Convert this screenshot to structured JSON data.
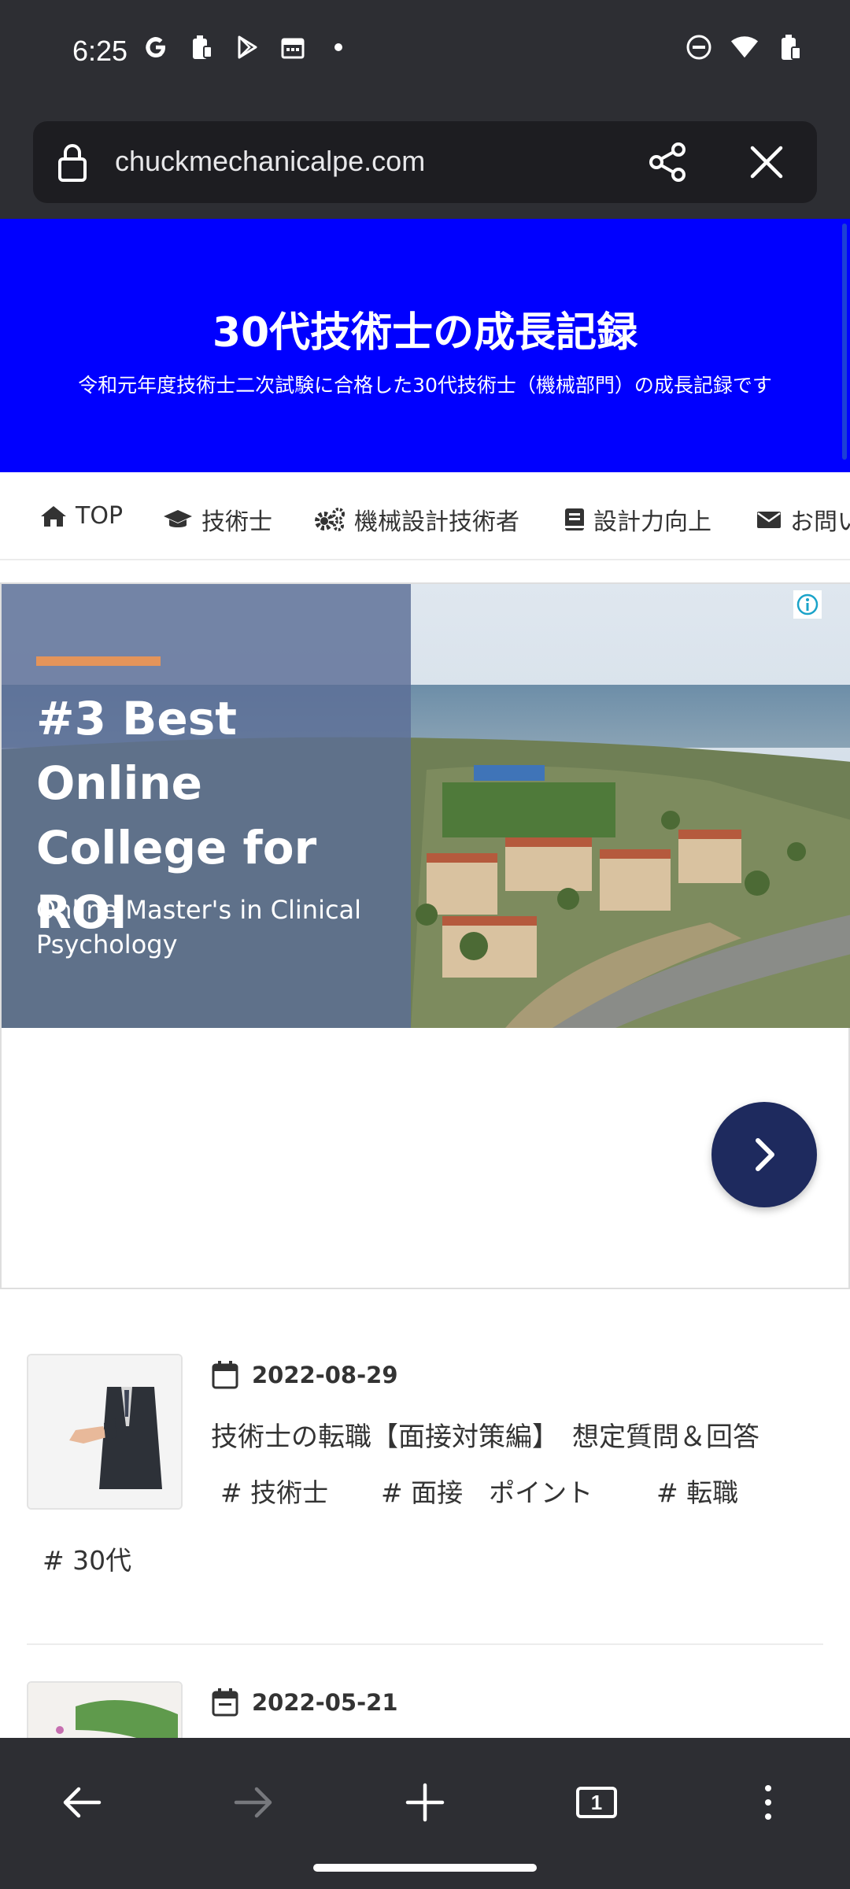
{
  "status_bar": {
    "time": "6:25",
    "left_icons": [
      "google-icon",
      "battery-saver-icon",
      "play-store-icon",
      "calendar-icon",
      "dot-icon"
    ],
    "right_icons": [
      "do-not-disturb-icon",
      "wifi-icon",
      "battery-icon"
    ]
  },
  "browser": {
    "url": "chuckmechanicalpe.com",
    "share_icon": "share-icon",
    "close_icon": "close-icon"
  },
  "site": {
    "title": "30代技術士の成長記録",
    "subtitle": "令和元年度技術士二次試験に合格した30代技術士（機械部門）の成長記録です",
    "header_color": "#0000ff"
  },
  "nav": {
    "items": [
      {
        "label": "TOP",
        "icon": "home-icon"
      },
      {
        "label": "技術士",
        "icon": "graduation-cap-icon"
      },
      {
        "label": "機械設計技術者",
        "icon": "gears-icon"
      },
      {
        "label": "設計力向上",
        "icon": "book-icon"
      },
      {
        "label": "お問い",
        "icon": "envelope-icon"
      }
    ]
  },
  "ad": {
    "headline": "#3 Best Online College for ROI",
    "subline": "Online Master's in Clinical Psychology",
    "info_icon": "info-icon",
    "next_icon": "chevron-right-icon",
    "accent_color": "#e4945a",
    "button_color": "#1e2a5e"
  },
  "articles": [
    {
      "date": "2022-08-29",
      "title": "技術士の転職【面接対策編】　想定質問＆回答",
      "tags": [
        "# 技術士",
        "# 面接　ポイント",
        "# 転職",
        "# 30代"
      ]
    },
    {
      "date": "2022-05-21",
      "title": "",
      "tags": []
    }
  ],
  "bottom_bar": {
    "tab_count": "1",
    "buttons": [
      "back-arrow-icon",
      "forward-arrow-icon",
      "new-tab-plus-icon",
      "tab-switcher-icon",
      "more-options-icon"
    ]
  }
}
